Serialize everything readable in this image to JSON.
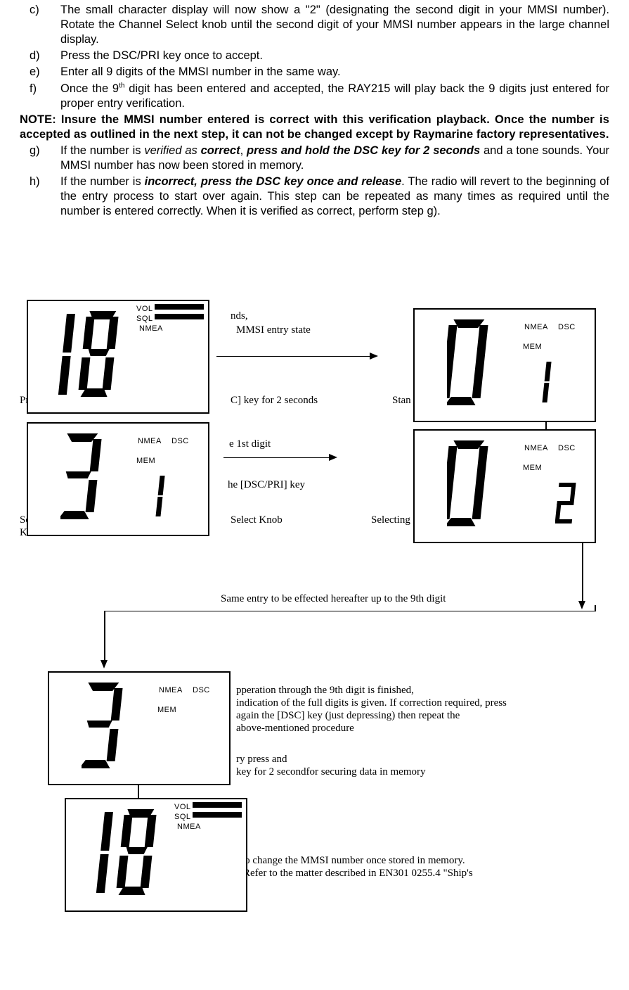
{
  "list": {
    "c": {
      "marker": "c)",
      "text": "The small character display will now show a \"2\" (designating the second digit in your MMSI number).  Rotate the Channel Select knob until the second digit of your MMSI number appears in the large channel display."
    },
    "d": {
      "marker": "d)",
      "text": "Press the DSC/PRI key once to accept."
    },
    "e": {
      "marker": "e)",
      "text": "Enter all 9 digits of the MMSI number in the same way."
    },
    "f": {
      "marker": "f)",
      "text_pre": "Once the 9",
      "sup": "th",
      "text_post": " digit has been entered and accepted, the RAY215 will play back the 9 digits just entered for proper entry verification."
    },
    "note": "NOTE:   Insure the MMSI number entered is correct with this verification playback.  Once the number is accepted as outlined in the next step, it can not be changed except by Raymarine factory representatives.",
    "g": {
      "marker": "g)",
      "text_pre": "If the number is ",
      "it1": "verified as ",
      "bi1": "correct",
      "mid": ", ",
      "bi2": "press and hold the DSC key for 2 seconds",
      "text_post": " and a tone sounds.  Your MMSI number has now been stored in memory."
    },
    "h": {
      "marker": "h)",
      "text_pre": "If the number is ",
      "bi1": "incorrect",
      "bi_sep": ", ",
      "bi2": "press the DSC key once and release",
      "text_post": ".  The radio will revert to the beginning of the entry process to start over again.  This step can be repeated as many times as required until the number is entered correctly.  When it is verified as correct, perform step g)."
    }
  },
  "diagram": {
    "txt1a": "nds,",
    "txt1b": "MMSI entry state",
    "txt2": "Press",
    "txt2b": "C] key for 2 seconds",
    "txt2c": "Stan",
    "txt3": "e 1st digit",
    "txt4": "he [DSC/PRI] key",
    "txt5a": "Se",
    "txt5b": "Select Knob",
    "txt5c": "Selecting",
    "txt5d": "Kn",
    "same": "Same entry to be effected hereafter up to the 9th digit",
    "p6a": "pperation through the 9th digit is finished,",
    "p6b": "indication of the full digits is given.  If correction required, press",
    "p6c": "again the [DSC] key (just depressing) then repeat the",
    "p6d": "above-mentioned procedure",
    "p7a": "ry press and",
    "p7b": "key for 2 secondfor securing data in memory",
    "p8a": "l to change the MMSI number once stored in memory.",
    "p8b": "Refer  to  the  matter  described  in  EN301  0255.4  \"Ship's"
  },
  "lcd": {
    "vol": "VOL",
    "sql": "SQL",
    "nmea": "NMEA",
    "dsc": "DSC",
    "mem": "MEM"
  }
}
